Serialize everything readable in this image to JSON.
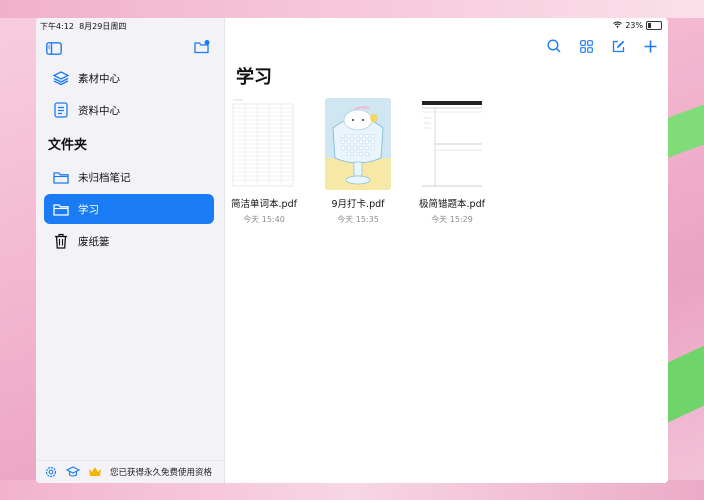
{
  "status_bar": {
    "time": "下午4:12",
    "date": "8月29日周四",
    "battery": "23%"
  },
  "sidebar": {
    "items_top": [
      {
        "label": "素材中心",
        "icon": "layers-icon"
      },
      {
        "label": "资料中心",
        "icon": "document-icon"
      }
    ],
    "section_title": "文件夹",
    "folders": [
      {
        "label": "未归档笔记",
        "icon": "folder-icon",
        "active": false
      },
      {
        "label": "学习",
        "icon": "folder-icon",
        "active": true
      },
      {
        "label": "废纸篓",
        "icon": "trash-icon",
        "active": false
      }
    ],
    "footer_text": "您已获得永久免费使用资格"
  },
  "main": {
    "title": "学习",
    "toolbar": [
      "search-icon",
      "grid-icon",
      "edit-icon",
      "plus-icon"
    ],
    "files": [
      {
        "name": "简洁单词本.pdf",
        "date": "今天 15:40"
      },
      {
        "name": "9月打卡.pdf",
        "date": "今天 15:35"
      },
      {
        "name": "极简错题本.pdf",
        "date": "今天 15:29"
      }
    ]
  },
  "colors": {
    "accent": "#1a7cf5",
    "sidebar_bg": "#f2f2f7",
    "secondary_text": "#8e8e93"
  }
}
